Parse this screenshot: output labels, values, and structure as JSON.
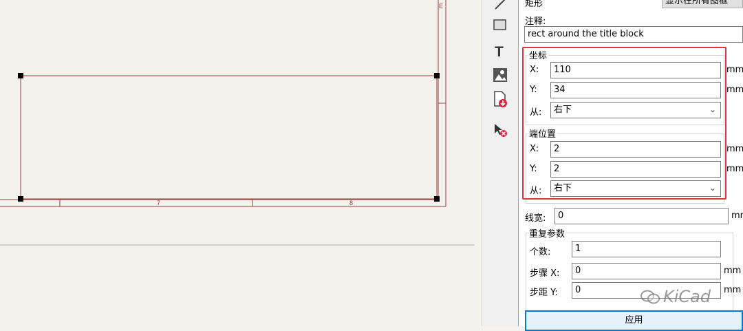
{
  "canvas": {
    "border_labels": {
      "right_top": "E",
      "bottom_7": "7",
      "bottom_8": "8"
    }
  },
  "panel": {
    "top_label": "矩形",
    "top_button": "显示在所有图框",
    "comment_label": "注释:",
    "comment_value": "rect around the title block",
    "coord_group": {
      "title": "坐标",
      "x_label": "X:",
      "x_value": "110",
      "x_unit": "mm",
      "y_label": "Y:",
      "y_value": "34",
      "y_unit": "mm",
      "from_label": "从:",
      "from_value": "右下"
    },
    "end_group": {
      "title": "端位置",
      "x_label": "X:",
      "x_value": "2",
      "x_unit": "mm",
      "y_label": "Y:",
      "y_value": "2",
      "y_unit": "mm",
      "from_label": "从:",
      "from_value": "右下"
    },
    "line_width": {
      "label": "线宽:",
      "value": "0",
      "unit": "mm"
    },
    "repeat_group": {
      "title": "重复参数",
      "count_label": "个数:",
      "count_value": "1",
      "step_x_label": "步骤 X:",
      "step_x_value": "0",
      "step_x_unit": "mm",
      "step_y_label": "步距 Y:",
      "step_y_value": "0",
      "step_y_unit": "mm"
    },
    "apply_button": "应用"
  },
  "watermark": {
    "text": "KiCad"
  },
  "colors": {
    "highlight": "#e2333f",
    "frame": "#a03a3a",
    "canvas_bg": "#f4f2ec"
  }
}
